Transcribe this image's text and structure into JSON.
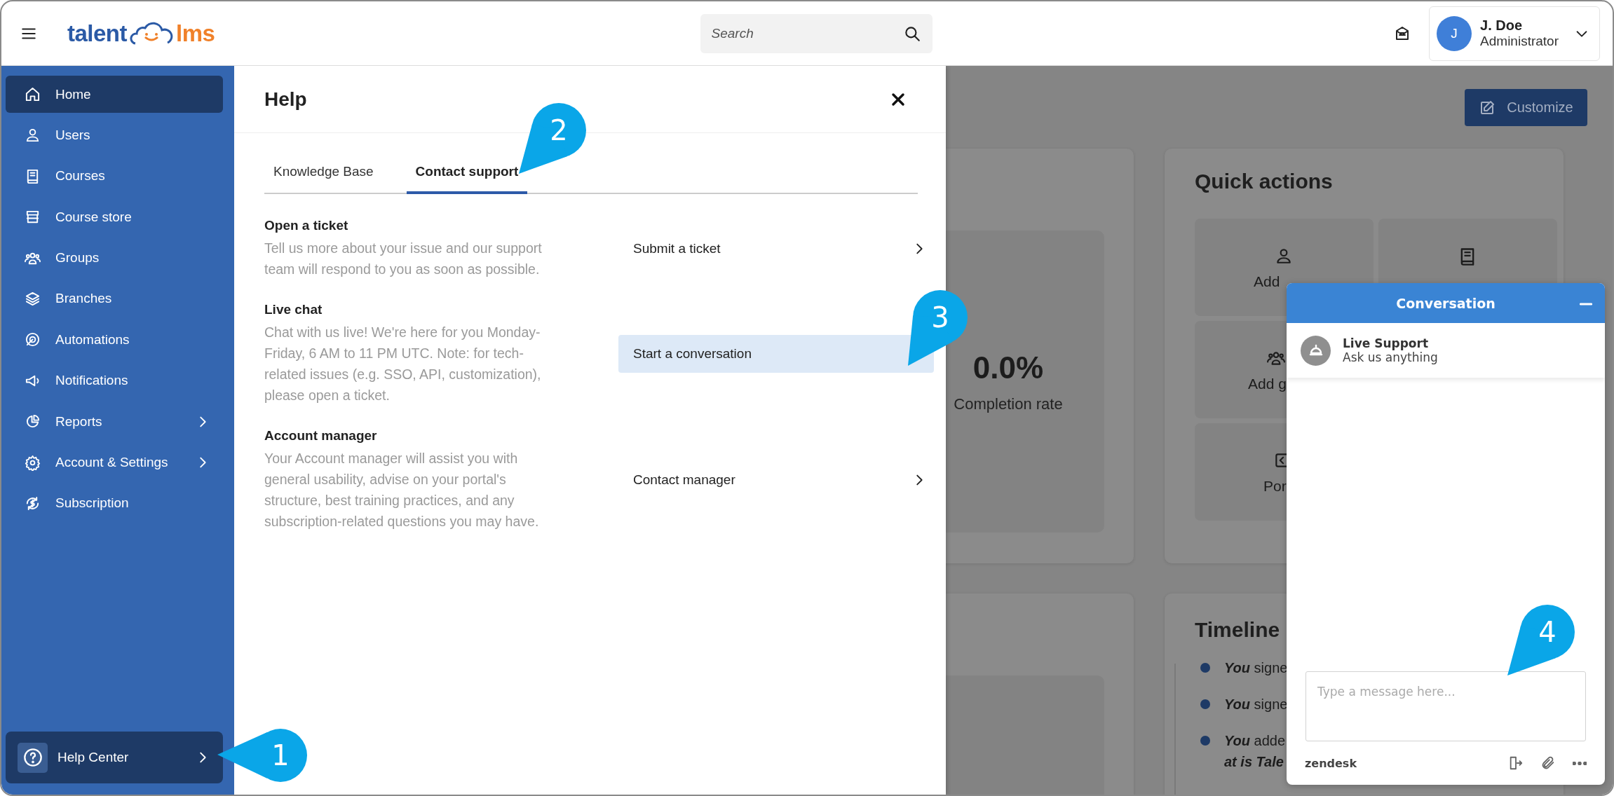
{
  "topbar": {
    "logo": {
      "left": "talent",
      "right": "lms"
    },
    "search": {
      "placeholder": "Search"
    },
    "user": {
      "initial": "J",
      "name": "J. Doe",
      "role": "Administrator"
    }
  },
  "sidebar": {
    "items": [
      {
        "label": "Home",
        "selected": true,
        "has_submenu": false
      },
      {
        "label": "Users",
        "selected": false,
        "has_submenu": false
      },
      {
        "label": "Courses",
        "selected": false,
        "has_submenu": false
      },
      {
        "label": "Course store",
        "selected": false,
        "has_submenu": false
      },
      {
        "label": "Groups",
        "selected": false,
        "has_submenu": false
      },
      {
        "label": "Branches",
        "selected": false,
        "has_submenu": false
      },
      {
        "label": "Automations",
        "selected": false,
        "has_submenu": false
      },
      {
        "label": "Notifications",
        "selected": false,
        "has_submenu": false
      },
      {
        "label": "Reports",
        "selected": false,
        "has_submenu": true
      },
      {
        "label": "Account & Settings",
        "selected": false,
        "has_submenu": true
      },
      {
        "label": "Subscription",
        "selected": false,
        "has_submenu": false
      }
    ],
    "help_center": {
      "label": "Help Center"
    }
  },
  "help_panel": {
    "title": "Help",
    "tabs": [
      {
        "label": "Knowledge Base",
        "selected": false
      },
      {
        "label": "Contact support",
        "selected": true
      }
    ],
    "sections": [
      {
        "heading": "Open a ticket",
        "description": "Tell us more about your issue and our support team will respond to you as soon as possible.",
        "action": "Submit a ticket",
        "highlighted": false
      },
      {
        "heading": "Live chat",
        "description": "Chat with us live! We're here for you Monday-Friday, 6 AM to 11 PM UTC. Note: for tech-related issues (e.g. SSO, API, customization), please open a ticket.",
        "action": "Start a conversation",
        "highlighted": true
      },
      {
        "heading": "Account manager",
        "description": "Your Account manager will assist you with general usability, advise on your portal's structure, best training practices, and any subscription-related questions you may have.",
        "action": "Contact manager",
        "highlighted": false
      }
    ]
  },
  "dashboard": {
    "customize_button": "Customize",
    "completion": {
      "value": "0.0%",
      "label": "Completion rate"
    },
    "quick_actions": {
      "title": "Quick actions",
      "tiles": [
        {
          "label": "Add"
        },
        {
          "label": "Add g"
        },
        {
          "label": "Por"
        }
      ]
    },
    "timeline": {
      "title": "Timeline",
      "entries": [
        {
          "text": "**You** signe"
        },
        {
          "text": "**You** signe"
        },
        {
          "text": "**You** adde",
          "continuation": "at is Tale"
        }
      ]
    }
  },
  "chat": {
    "title": "Conversation",
    "agent_name": "Live Support",
    "agent_status": "Ask us anything",
    "placeholder": "Type a message here...",
    "brand": "zendesk"
  },
  "callouts": [
    {
      "number": "1"
    },
    {
      "number": "2"
    },
    {
      "number": "3"
    },
    {
      "number": "4"
    }
  ]
}
